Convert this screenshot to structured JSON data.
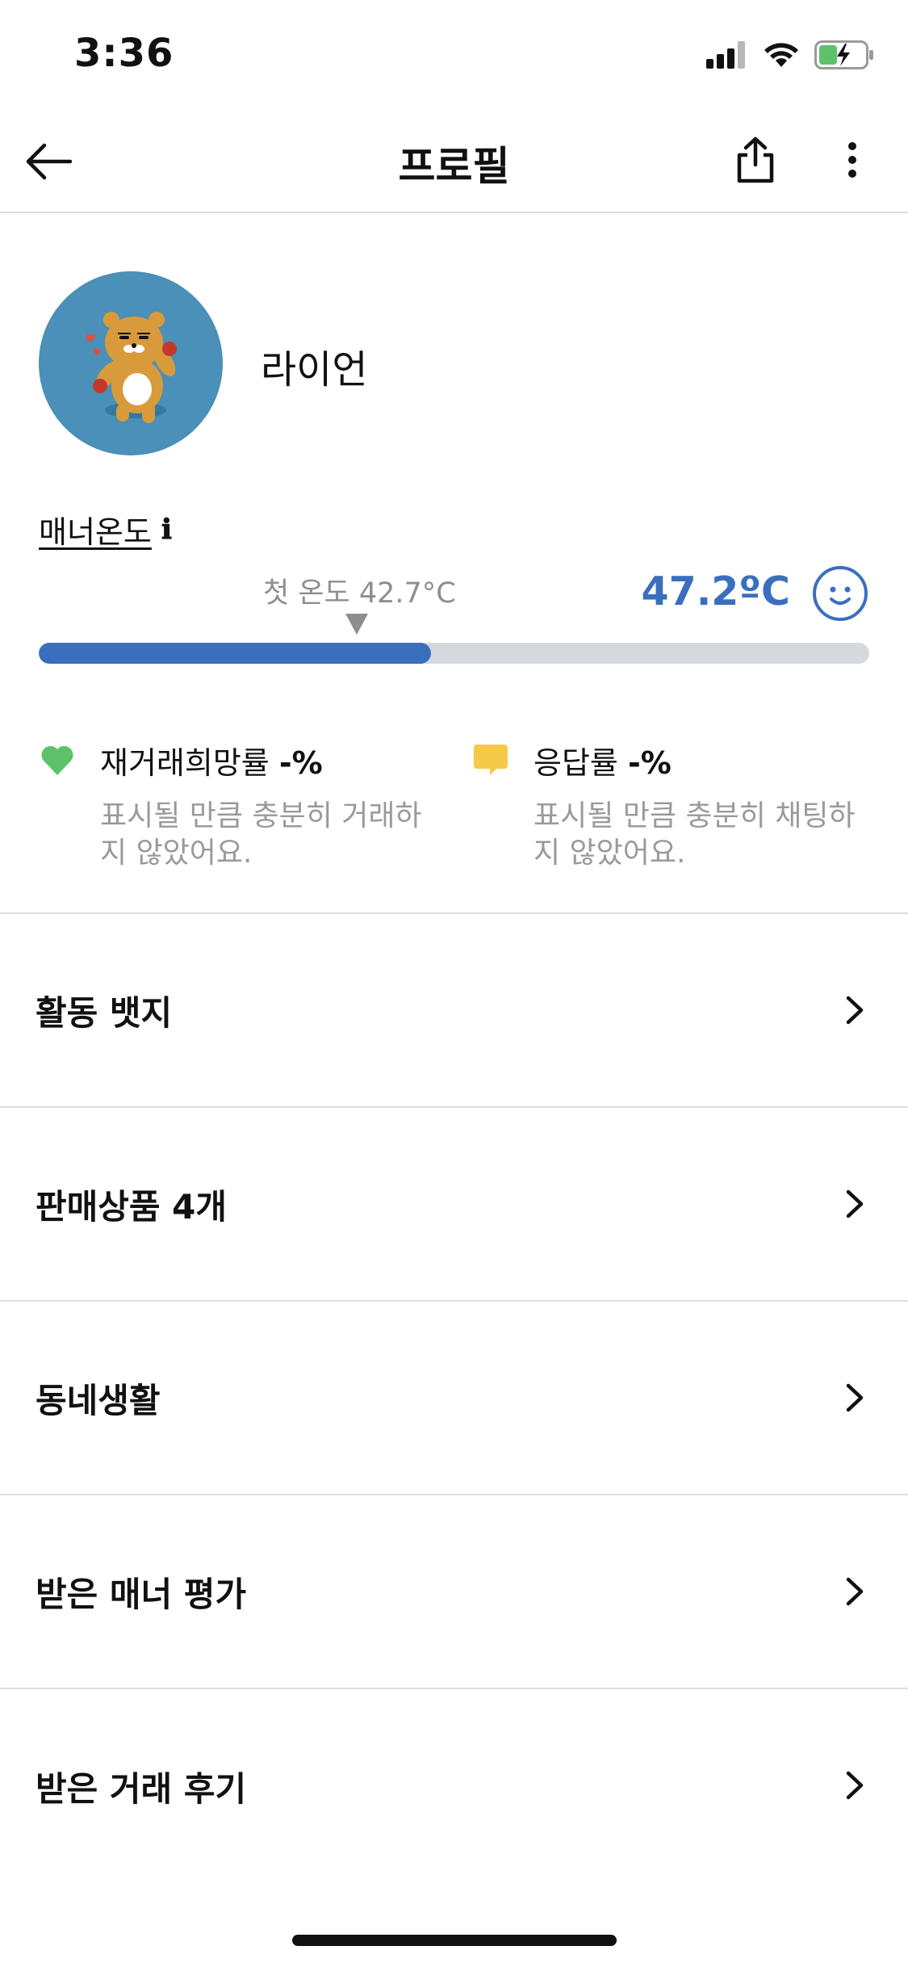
{
  "status_bar": {
    "time": "3:36",
    "icons": [
      "signal-icon",
      "wifi-icon",
      "battery-charging-icon"
    ]
  },
  "header": {
    "title": "프로필",
    "back_icon": "arrow-left-icon",
    "share_icon": "share-icon",
    "more_icon": "more-vertical-icon"
  },
  "profile": {
    "nickname": "라이언",
    "avatar_icon": "lion-avatar-icon",
    "avatar_bg": "#4a90b8"
  },
  "manner": {
    "title": "매너온도",
    "info_icon": "ℹ",
    "first_temp_label": "첫 온도 42.7°C",
    "current_temp": "47.2ºC",
    "current_temp_value": 47.2,
    "first_temp_value": 42.7,
    "accent_color": "#3a6fbe",
    "bar_fill_fraction": 0.472,
    "face_icon": "smile-face-icon"
  },
  "stats": {
    "rebuy": {
      "label": "재거래희망률",
      "value": "-%",
      "desc": "표시될 만큼 충분히 거래하지 않았어요.",
      "icon": "heart-icon",
      "color": "#5ec26a"
    },
    "response": {
      "label": "응답률",
      "value": "-%",
      "desc": "표시될 만큼 충분히 채팅하지 않았어요.",
      "icon": "chat-bubble-icon",
      "color": "#f7c948"
    }
  },
  "menu": {
    "items": [
      {
        "label": "활동 뱃지"
      },
      {
        "label": "판매상품 4개"
      },
      {
        "label": "동네생활"
      },
      {
        "label": "받은 매너 평가"
      },
      {
        "label": "받은 거래 후기"
      }
    ]
  }
}
